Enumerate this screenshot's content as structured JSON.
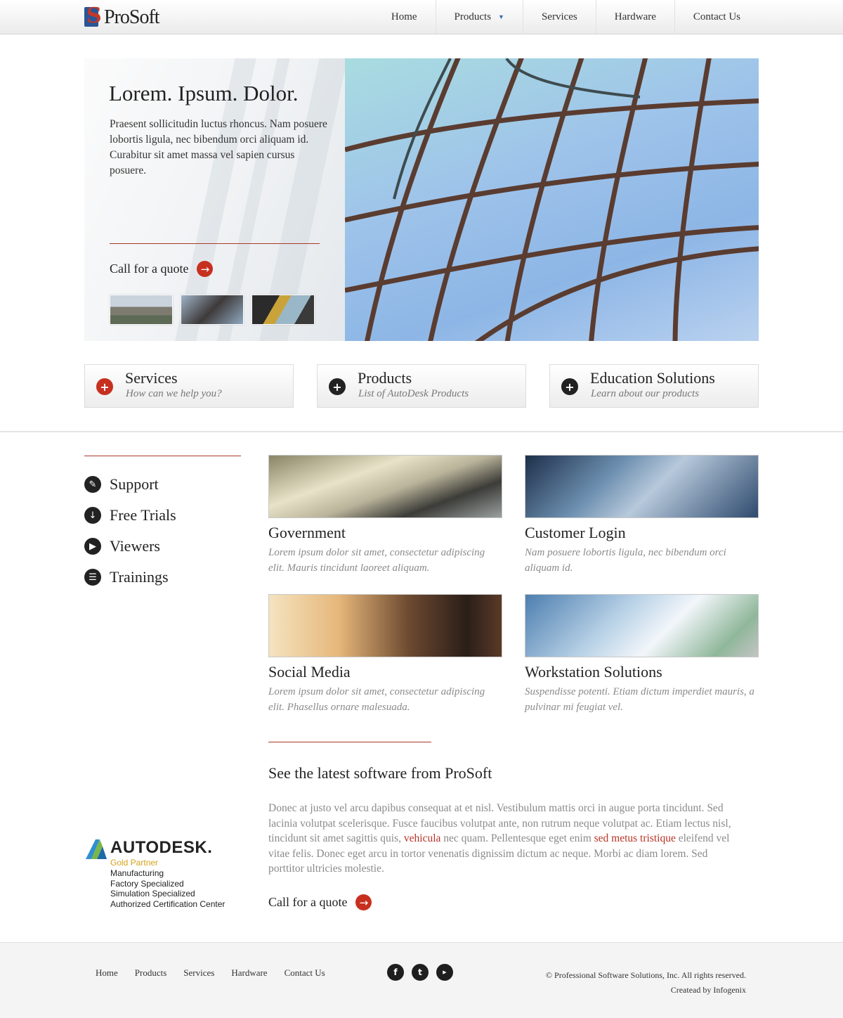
{
  "header": {
    "logo_text": "ProSoft",
    "nav": [
      {
        "label": "Home"
      },
      {
        "label": "Products"
      },
      {
        "label": "Services"
      },
      {
        "label": "Hardware"
      },
      {
        "label": "Contact Us"
      }
    ]
  },
  "hero": {
    "title": "Lorem. Ipsum. Dolor.",
    "text": "Praesent sollicitudin luctus rhoncus. Nam posuere lobortis ligula, nec bibendum orci aliquam id. Curabitur sit amet massa vel sapien cursus posuere.",
    "cta": "Call for a quote"
  },
  "features": [
    {
      "title": "Services",
      "subtitle": "How can we help you?",
      "icon_color": "#c7301f"
    },
    {
      "title": "Products",
      "subtitle": "List of AutoDesk Products",
      "icon_color": "#222222"
    },
    {
      "title": "Education Solutions",
      "subtitle": "Learn about our products",
      "icon_color": "#222222"
    }
  ],
  "sidebar": {
    "items": [
      {
        "label": "Support",
        "icon": "wrench-icon"
      },
      {
        "label": "Free Trials",
        "icon": "download-icon"
      },
      {
        "label": "Viewers",
        "icon": "play-icon"
      },
      {
        "label": "Trainings",
        "icon": "list-icon"
      }
    ]
  },
  "autodesk": {
    "brand": "AUTODESK.",
    "tier": "Gold Partner",
    "lines": [
      "Manufacturing",
      "Factory Specialized",
      "Simulation Specialized",
      "Authorized Certification Center"
    ]
  },
  "cards": [
    {
      "title": "Government",
      "text": "Lorem ipsum dolor sit amet, consectetur adipiscing elit. Mauris tincidunt laoreet aliquam."
    },
    {
      "title": "Customer Login",
      "text": "Nam posuere lobortis ligula, nec bibendum orci aliquam id."
    },
    {
      "title": "Social Media",
      "text": "Lorem ipsum dolor sit amet, consectetur adipiscing elit. Phasellus ornare malesuada."
    },
    {
      "title": "Workstation Solutions",
      "text": "Suspendisse potenti. Etiam dictum imperdiet mauris, a pulvinar mi feugiat vel."
    }
  ],
  "latest": {
    "title": "See the latest software from ProSoft",
    "text_1": "Donec at justo vel arcu dapibus consequat at et nisl. Vestibulum mattis orci in augue porta tincidunt. Sed lacinia volutpat scelerisque. Fusce faucibus volutpat ante, non rutrum neque volutpat ac. Etiam lectus nisl, tincidunt sit amet sagittis quis, ",
    "link_1": "vehicula",
    "text_2": " nec quam. Pellentesque eget enim ",
    "link_2": "sed metus tristique",
    "text_3": " eleifend vel vitae felis. Donec eget arcu in tortor venenatis dignissim dictum ac neque. Morbi ac diam lorem. Sed porttitor ultricies molestie.",
    "cta": "Call for a quote"
  },
  "footer": {
    "links": [
      "Home",
      "Products",
      "Services",
      "Hardware",
      "Contact Us"
    ],
    "social": [
      "facebook-icon",
      "twitter-icon",
      "youtube-icon"
    ],
    "copyright": "© Professional Software Solutions, Inc. All rights reserved.",
    "credit": "Createad by Infogenix"
  },
  "colors": {
    "accent": "#c7301f",
    "rule": "#a8392b"
  }
}
